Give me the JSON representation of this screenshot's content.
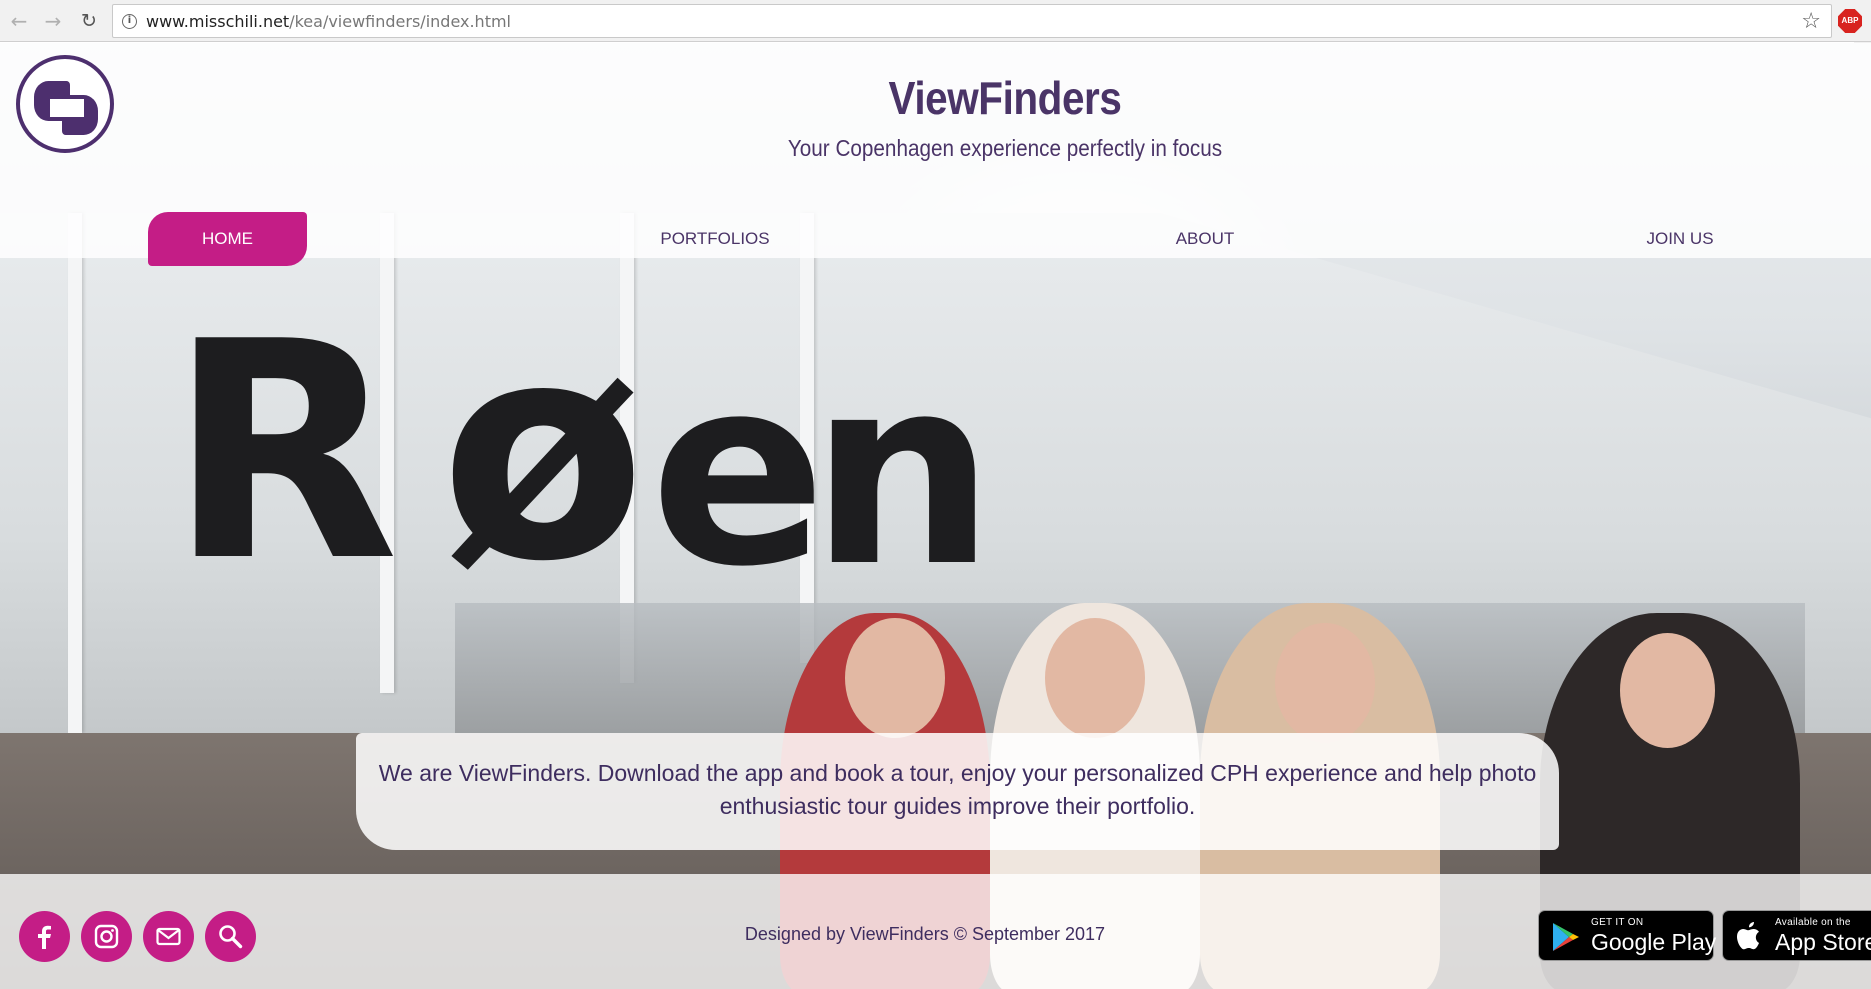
{
  "browser": {
    "url_domain": "www.misschili.net",
    "url_path": "/kea/viewfinders/index.html",
    "abp_label": "ABP"
  },
  "site": {
    "title": "ViewFinders",
    "tagline": "Your Copenhagen experience perfectly in focus"
  },
  "menu": {
    "items": [
      {
        "label": "HOME",
        "active": true
      },
      {
        "label": "PORTFOLIOS",
        "active": false
      },
      {
        "label": "ABOUT",
        "active": false
      },
      {
        "label": "JOIN US",
        "active": false
      }
    ]
  },
  "hero": {
    "sign_text": [
      "R",
      "ø",
      "e",
      "n"
    ]
  },
  "intro": {
    "text": "We are ViewFinders. Download the app and book a tour, enjoy your personalized CPH experience and help photo enthusiastic tour guides improve their portfolio."
  },
  "footer": {
    "social": [
      {
        "icon": "facebook-icon"
      },
      {
        "icon": "instagram-icon"
      },
      {
        "icon": "mail-icon"
      },
      {
        "icon": "search-icon"
      }
    ],
    "copyright": "Designed by ViewFinders © September 2017",
    "stores": [
      {
        "small": "GET IT ON",
        "big": "Google Play",
        "icon": "google-play-icon"
      },
      {
        "small": "Available on the",
        "big": "App Store",
        "icon": "apple-icon"
      }
    ]
  },
  "colors": {
    "brand_purple": "#4a3467",
    "accent_magenta": "#c41d86"
  }
}
